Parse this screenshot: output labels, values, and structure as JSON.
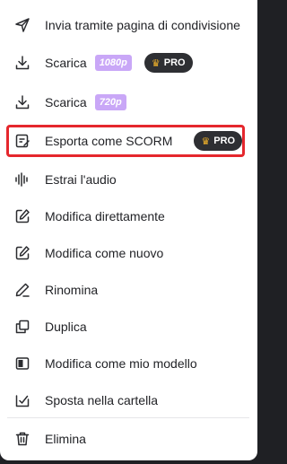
{
  "menu": {
    "items": [
      {
        "label": "Invia tramite pagina di condivisione",
        "icon": "send-icon"
      },
      {
        "label": "Scarica",
        "quality": "1080p",
        "badge": "PRO",
        "icon": "download-icon"
      },
      {
        "label": "Scarica",
        "quality": "720p",
        "icon": "download-icon"
      },
      {
        "label": "Esporta come SCORM",
        "badge": "PRO",
        "icon": "scorm-export-icon",
        "selected": true
      },
      {
        "label": "Estrai l'audio",
        "icon": "audio-waveform-icon"
      },
      {
        "label": "Modifica direttamente",
        "icon": "edit-icon"
      },
      {
        "label": "Modifica come nuovo",
        "icon": "edit-copy-icon"
      },
      {
        "label": "Rinomina",
        "icon": "pen-icon"
      },
      {
        "label": "Duplica",
        "icon": "duplicate-icon"
      },
      {
        "label": "Modifica come mio modello",
        "icon": "template-icon"
      },
      {
        "label": "Sposta nella cartella",
        "icon": "move-folder-icon"
      },
      {
        "label": "Elimina",
        "icon": "trash-icon"
      }
    ]
  },
  "colors": {
    "quality_badge": "#c9a7f7",
    "pro_badge": "#2e2f33",
    "crown": "#f5b52a",
    "highlight_border": "#e5272d"
  }
}
